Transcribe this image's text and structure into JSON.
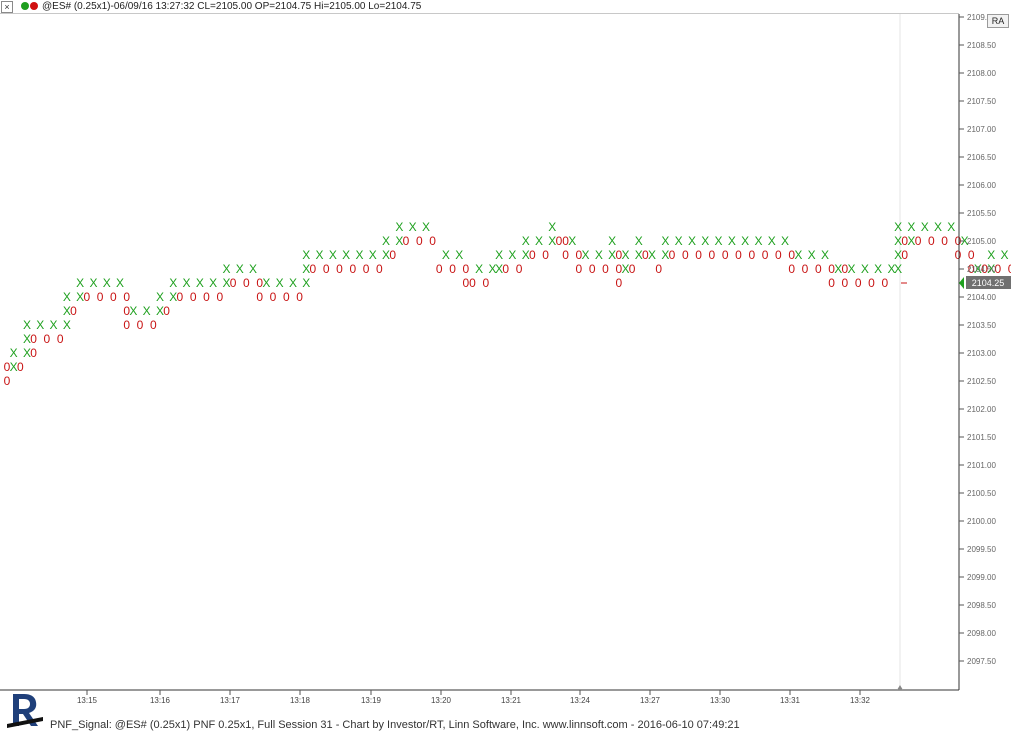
{
  "header": {
    "close_label": "×",
    "title": "@ES# (0.25x1)-06/09/16 13:27:32 CL=2105.00 OP=2104.75 Hi=2105.00 Lo=2104.75"
  },
  "ra_button": "RA",
  "footer": {
    "text": "PNF_Signal: @ES# (0.25x1) PNF 0.25x1, Full Session 31 - Chart by Investor/RT, Linn Software, Inc. www.linnsoft.com - 2016-06-10 07:49:21"
  },
  "colors": {
    "x": "#1ea01e",
    "o": "#c81414",
    "axis": "#444444",
    "price_tag": "#707070"
  },
  "chart_data": {
    "type": "point-and-figure",
    "box_size": 0.25,
    "reversal": 1,
    "ylim": [
      2097.25,
      2109.0
    ],
    "y_ticks": [
      "2097.50",
      "2098.00",
      "2098.50",
      "2099.00",
      "2099.50",
      "2100.00",
      "2100.50",
      "2101.00",
      "2101.50",
      "2102.00",
      "2102.50",
      "2103.00",
      "2103.50",
      "2104.00",
      "2104.50",
      "2105.00",
      "2105.50",
      "2106.00",
      "2106.50",
      "2107.00",
      "2107.50",
      "2108.00",
      "2108.50",
      "2109.00"
    ],
    "x_ticks": [
      "13:15",
      "13:16",
      "13:17",
      "13:18",
      "13:19",
      "13:20",
      "13:21",
      "13:24",
      "13:27",
      "13:30",
      "13:31",
      "13:32"
    ],
    "last_price": "2104.25",
    "columns": [
      {
        "t": "O",
        "hi": 2102.75,
        "lo": 2102.5
      },
      {
        "t": "X",
        "hi": 2103.0,
        "lo": 2102.75
      },
      {
        "t": "O",
        "hi": 2102.75,
        "lo": 2102.75
      },
      {
        "t": "X",
        "hi": 2103.5,
        "lo": 2103.0
      },
      {
        "t": "O",
        "hi": 2103.25,
        "lo": 2103.0
      },
      {
        "t": "X",
        "hi": 2103.5,
        "lo": 2103.5
      },
      {
        "t": "O",
        "hi": 2103.25,
        "lo": 2103.25
      },
      {
        "t": "X",
        "hi": 2103.5,
        "lo": 2103.5
      },
      {
        "t": "O",
        "hi": 2103.25,
        "lo": 2103.25
      },
      {
        "t": "X",
        "hi": 2104.0,
        "lo": 2103.5
      },
      {
        "t": "O",
        "hi": 2103.75,
        "lo": 2103.75
      },
      {
        "t": "X",
        "hi": 2104.25,
        "lo": 2104.0
      },
      {
        "t": "O",
        "hi": 2104.0,
        "lo": 2104.0
      },
      {
        "t": "X",
        "hi": 2104.25,
        "lo": 2104.25
      },
      {
        "t": "O",
        "hi": 2104.0,
        "lo": 2104.0
      },
      {
        "t": "X",
        "hi": 2104.25,
        "lo": 2104.25
      },
      {
        "t": "O",
        "hi": 2104.0,
        "lo": 2104.0
      },
      {
        "t": "X",
        "hi": 2104.25,
        "lo": 2104.25
      },
      {
        "t": "O",
        "hi": 2104.0,
        "lo": 2103.5
      },
      {
        "t": "X",
        "hi": 2103.75,
        "lo": 2103.75
      },
      {
        "t": "O",
        "hi": 2103.5,
        "lo": 2103.5
      },
      {
        "t": "X",
        "hi": 2103.75,
        "lo": 2103.75
      },
      {
        "t": "O",
        "hi": 2103.5,
        "lo": 2103.5
      },
      {
        "t": "X",
        "hi": 2104.0,
        "lo": 2103.75
      },
      {
        "t": "O",
        "hi": 2103.75,
        "lo": 2103.75
      },
      {
        "t": "X",
        "hi": 2104.25,
        "lo": 2104.0
      },
      {
        "t": "O",
        "hi": 2104.0,
        "lo": 2104.0
      },
      {
        "t": "X",
        "hi": 2104.25,
        "lo": 2104.25
      },
      {
        "t": "O",
        "hi": 2104.0,
        "lo": 2104.0
      },
      {
        "t": "X",
        "hi": 2104.25,
        "lo": 2104.25
      },
      {
        "t": "O",
        "hi": 2104.0,
        "lo": 2104.0
      },
      {
        "t": "X",
        "hi": 2104.25,
        "lo": 2104.25
      },
      {
        "t": "O",
        "hi": 2104.0,
        "lo": 2104.0
      },
      {
        "t": "X",
        "hi": 2104.5,
        "lo": 2104.25
      },
      {
        "t": "O",
        "hi": 2104.25,
        "lo": 2104.25
      },
      {
        "t": "X",
        "hi": 2104.5,
        "lo": 2104.5
      },
      {
        "t": "O",
        "hi": 2104.25,
        "lo": 2104.25
      },
      {
        "t": "X",
        "hi": 2104.5,
        "lo": 2104.5
      },
      {
        "t": "O",
        "hi": 2104.25,
        "lo": 2104.0
      },
      {
        "t": "X",
        "hi": 2104.25,
        "lo": 2104.25
      },
      {
        "t": "O",
        "hi": 2104.0,
        "lo": 2104.0
      },
      {
        "t": "X",
        "hi": 2104.25,
        "lo": 2104.25
      },
      {
        "t": "O",
        "hi": 2104.0,
        "lo": 2104.0
      },
      {
        "t": "X",
        "hi": 2104.25,
        "lo": 2104.25
      },
      {
        "t": "O",
        "hi": 2104.0,
        "lo": 2104.0
      },
      {
        "t": "X",
        "hi": 2104.75,
        "lo": 2104.25
      },
      {
        "t": "O",
        "hi": 2104.5,
        "lo": 2104.5
      },
      {
        "t": "X",
        "hi": 2104.75,
        "lo": 2104.75
      },
      {
        "t": "O",
        "hi": 2104.5,
        "lo": 2104.5
      },
      {
        "t": "X",
        "hi": 2104.75,
        "lo": 2104.75
      },
      {
        "t": "O",
        "hi": 2104.5,
        "lo": 2104.5
      },
      {
        "t": "X",
        "hi": 2104.75,
        "lo": 2104.75
      },
      {
        "t": "O",
        "hi": 2104.5,
        "lo": 2104.5
      },
      {
        "t": "X",
        "hi": 2104.75,
        "lo": 2104.75
      },
      {
        "t": "O",
        "hi": 2104.5,
        "lo": 2104.5
      },
      {
        "t": "X",
        "hi": 2104.75,
        "lo": 2104.75
      },
      {
        "t": "O",
        "hi": 2104.5,
        "lo": 2104.5
      },
      {
        "t": "X",
        "hi": 2105.0,
        "lo": 2104.75
      },
      {
        "t": "O",
        "hi": 2104.75,
        "lo": 2104.75
      },
      {
        "t": "X",
        "hi": 2105.25,
        "lo": 2105.0
      },
      {
        "t": "O",
        "hi": 2105.0,
        "lo": 2105.0
      },
      {
        "t": "X",
        "hi": 2105.25,
        "lo": 2105.25
      },
      {
        "t": "O",
        "hi": 2105.0,
        "lo": 2105.0
      },
      {
        "t": "X",
        "hi": 2105.25,
        "lo": 2105.25
      },
      {
        "t": "O",
        "hi": 2105.0,
        "lo": 2105.0
      },
      {
        "t": "O",
        "hi": 2104.5,
        "lo": 2104.5
      },
      {
        "t": "X",
        "hi": 2104.75,
        "lo": 2104.75
      },
      {
        "t": "O",
        "hi": 2104.5,
        "lo": 2104.5
      },
      {
        "t": "X",
        "hi": 2104.75,
        "lo": 2104.75
      },
      {
        "t": "O",
        "hi": 2104.5,
        "lo": 2104.25
      },
      {
        "t": "O",
        "hi": 2104.25,
        "lo": 2104.25
      },
      {
        "t": "X",
        "hi": 2104.5,
        "lo": 2104.5
      },
      {
        "t": "O",
        "hi": 2104.25,
        "lo": 2104.25
      },
      {
        "t": "X",
        "hi": 2104.5,
        "lo": 2104.5
      },
      {
        "t": "X",
        "hi": 2104.75,
        "lo": 2104.5
      },
      {
        "t": "O",
        "hi": 2104.5,
        "lo": 2104.5
      },
      {
        "t": "X",
        "hi": 2104.75,
        "lo": 2104.75
      },
      {
        "t": "O",
        "hi": 2104.5,
        "lo": 2104.5
      },
      {
        "t": "X",
        "hi": 2105.0,
        "lo": 2104.75
      },
      {
        "t": "O",
        "hi": 2104.75,
        "lo": 2104.75
      },
      {
        "t": "X",
        "hi": 2105.0,
        "lo": 2105.0
      },
      {
        "t": "O",
        "hi": 2104.75,
        "lo": 2104.75
      },
      {
        "t": "X",
        "hi": 2105.25,
        "lo": 2105.0
      },
      {
        "t": "O",
        "hi": 2105.0,
        "lo": 2105.0
      },
      {
        "t": "O",
        "hi": 2105.0,
        "lo": 2104.75
      },
      {
        "t": "X",
        "hi": 2105.0,
        "lo": 2105.0
      },
      {
        "t": "O",
        "hi": 2104.75,
        "lo": 2104.5
      },
      {
        "t": "X",
        "hi": 2104.75,
        "lo": 2104.75
      },
      {
        "t": "O",
        "hi": 2104.5,
        "lo": 2104.5
      },
      {
        "t": "X",
        "hi": 2104.75,
        "lo": 2104.75
      },
      {
        "t": "O",
        "hi": 2104.5,
        "lo": 2104.5
      },
      {
        "t": "X",
        "hi": 2105.0,
        "lo": 2104.75
      },
      {
        "t": "O",
        "hi": 2104.75,
        "lo": 2104.25
      },
      {
        "t": "X",
        "hi": 2104.75,
        "lo": 2104.5
      },
      {
        "t": "O",
        "hi": 2104.5,
        "lo": 2104.5
      },
      {
        "t": "X",
        "hi": 2105.0,
        "lo": 2104.75
      },
      {
        "t": "O",
        "hi": 2104.75,
        "lo": 2104.75
      },
      {
        "t": "X",
        "hi": 2104.75,
        "lo": 2104.75
      },
      {
        "t": "O",
        "hi": 2104.5,
        "lo": 2104.5
      },
      {
        "t": "X",
        "hi": 2105.0,
        "lo": 2104.75
      },
      {
        "t": "O",
        "hi": 2104.75,
        "lo": 2104.75
      },
      {
        "t": "X",
        "hi": 2105.0,
        "lo": 2105.0
      },
      {
        "t": "O",
        "hi": 2104.75,
        "lo": 2104.75
      },
      {
        "t": "X",
        "hi": 2105.0,
        "lo": 2105.0
      },
      {
        "t": "O",
        "hi": 2104.75,
        "lo": 2104.75
      },
      {
        "t": "X",
        "hi": 2105.0,
        "lo": 2105.0
      },
      {
        "t": "O",
        "hi": 2104.75,
        "lo": 2104.75
      },
      {
        "t": "X",
        "hi": 2105.0,
        "lo": 2105.0
      },
      {
        "t": "O",
        "hi": 2104.75,
        "lo": 2104.75
      },
      {
        "t": "X",
        "hi": 2105.0,
        "lo": 2105.0
      },
      {
        "t": "O",
        "hi": 2104.75,
        "lo": 2104.75
      },
      {
        "t": "X",
        "hi": 2105.0,
        "lo": 2105.0
      },
      {
        "t": "O",
        "hi": 2104.75,
        "lo": 2104.75
      },
      {
        "t": "X",
        "hi": 2105.0,
        "lo": 2105.0
      },
      {
        "t": "O",
        "hi": 2104.75,
        "lo": 2104.75
      },
      {
        "t": "X",
        "hi": 2105.0,
        "lo": 2105.0
      },
      {
        "t": "O",
        "hi": 2104.75,
        "lo": 2104.75
      },
      {
        "t": "X",
        "hi": 2105.0,
        "lo": 2105.0
      },
      {
        "t": "O",
        "hi": 2104.75,
        "lo": 2104.5
      },
      {
        "t": "X",
        "hi": 2104.75,
        "lo": 2104.75
      },
      {
        "t": "O",
        "hi": 2104.5,
        "lo": 2104.5
      },
      {
        "t": "X",
        "hi": 2104.75,
        "lo": 2104.75
      },
      {
        "t": "O",
        "hi": 2104.5,
        "lo": 2104.5
      },
      {
        "t": "X",
        "hi": 2104.75,
        "lo": 2104.75
      },
      {
        "t": "O",
        "hi": 2104.5,
        "lo": 2104.25
      },
      {
        "t": "X",
        "hi": 2104.5,
        "lo": 2104.5
      },
      {
        "t": "O",
        "hi": 2104.5,
        "lo": 2104.25
      },
      {
        "t": "X",
        "hi": 2104.5,
        "lo": 2104.5
      },
      {
        "t": "O",
        "hi": 2104.25,
        "lo": 2104.25
      },
      {
        "t": "X",
        "hi": 2104.5,
        "lo": 2104.5
      },
      {
        "t": "O",
        "hi": 2104.25,
        "lo": 2104.25
      },
      {
        "t": "X",
        "hi": 2104.5,
        "lo": 2104.5
      },
      {
        "t": "O",
        "hi": 2104.25,
        "lo": 2104.25
      },
      {
        "t": "X",
        "hi": 2104.5,
        "lo": 2104.5
      },
      {
        "t": "X",
        "hi": 2105.25,
        "lo": 2104.5
      },
      {
        "t": "O",
        "hi": 2105.0,
        "lo": 2104.75
      },
      {
        "t": "X",
        "hi": 2105.25,
        "lo": 2105.0
      },
      {
        "t": "O",
        "hi": 2105.0,
        "lo": 2105.0
      },
      {
        "t": "X",
        "hi": 2105.25,
        "lo": 2105.25
      },
      {
        "t": "O",
        "hi": 2105.0,
        "lo": 2105.0
      },
      {
        "t": "X",
        "hi": 2105.25,
        "lo": 2105.25
      },
      {
        "t": "O",
        "hi": 2105.0,
        "lo": 2105.0
      },
      {
        "t": "X",
        "hi": 2105.25,
        "lo": 2105.25
      },
      {
        "t": "O",
        "hi": 2105.0,
        "lo": 2104.75
      },
      {
        "t": "X",
        "hi": 2105.0,
        "lo": 2105.0
      },
      {
        "t": "O",
        "hi": 2104.75,
        "lo": 2104.25
      },
      {
        "t": "X",
        "hi": 2104.5,
        "lo": 2104.5
      },
      {
        "t": "O",
        "hi": 2104.5,
        "lo": 2104.25
      },
      {
        "t": "X",
        "hi": 2104.75,
        "lo": 2104.5
      },
      {
        "t": "O",
        "hi": 2104.5,
        "lo": 2104.5
      },
      {
        "t": "X",
        "hi": 2104.75,
        "lo": 2104.75
      },
      {
        "t": "O",
        "hi": 2104.5,
        "lo": 2104.25
      },
      {
        "t": "X",
        "hi": 2104.5,
        "lo": 2104.5
      },
      {
        "t": "O",
        "hi": 2104.25,
        "lo": 2104.25
      },
      {
        "t": "X",
        "hi": 2104.5,
        "lo": 2104.5
      },
      {
        "t": "O",
        "hi": 2104.25,
        "lo": 2104.25
      },
      {
        "t": "O",
        "hi": 2104.25,
        "lo": 2104.25
      }
    ]
  }
}
